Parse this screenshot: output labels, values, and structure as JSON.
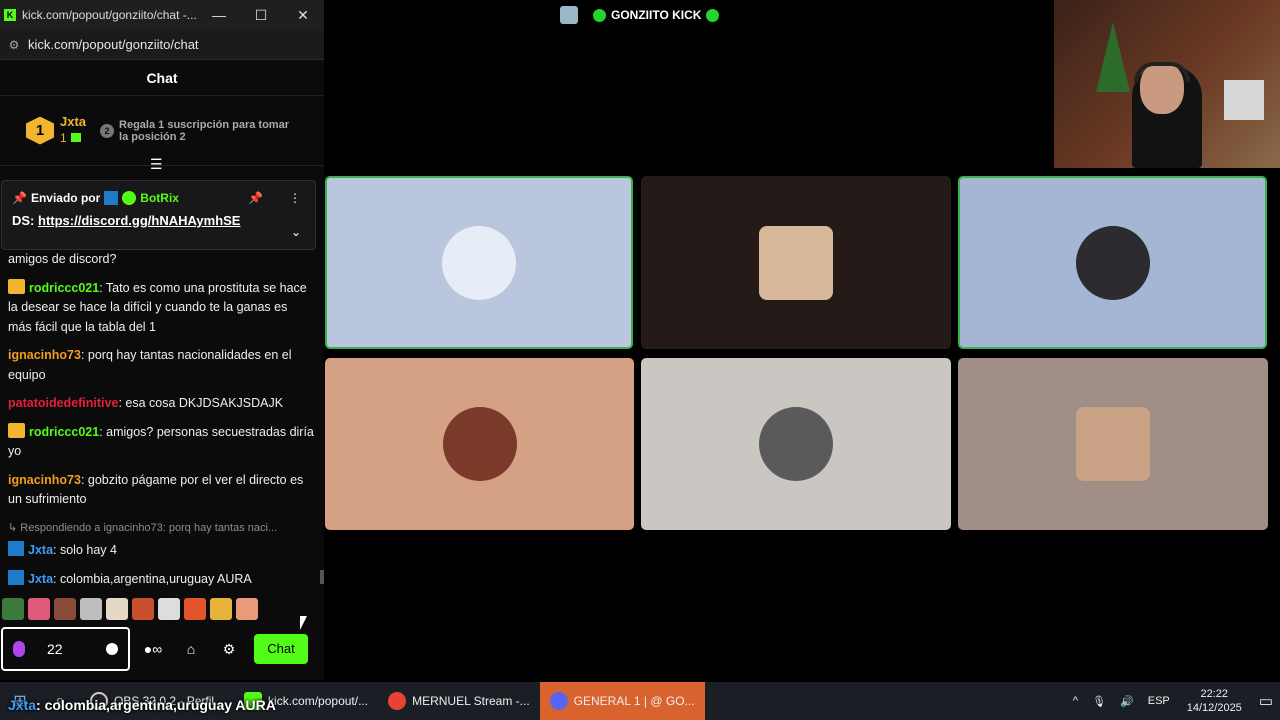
{
  "window": {
    "title": "kick.com/popout/gonziito/chat -...",
    "url": "kick.com/popout/gonziito/chat",
    "header": "Chat"
  },
  "leaderboard": {
    "rank": "1",
    "name": "Jxta",
    "count": "1",
    "slot2_rank": "2",
    "slot2_text": "Regala 1 suscripción para tomar la posición 2"
  },
  "pinned": {
    "sent_by": "Enviado por",
    "bot_name": "BotRix",
    "prefix": "DS:",
    "link": "https://discord.gg/hNAHAymhSE"
  },
  "messages": [
    {
      "user": "",
      "text": "amigos de discord?"
    },
    {
      "user": "rodriccc021",
      "color": "green",
      "badge": "crown",
      "text": ": Tato es como una prostituta se hace la desear se hace la difícil y cuando te la ganas es más fácil que la tabla del 1"
    },
    {
      "user": "ignacinho73",
      "color": "orange",
      "text": ": porq hay tantas nacionalidades en el equipo"
    },
    {
      "user": "patatoidedefinitive",
      "color": "red",
      "text": ": esa cosa DKJDSAKJSDAJK"
    },
    {
      "user": "rodriccc021",
      "color": "green",
      "badge": "crown",
      "text": ": amigos? personas secuestradas diría yo"
    },
    {
      "user": "ignacinho73",
      "color": "orange",
      "text": ": gobzito págame por el ver el directo es un sufrimiento"
    }
  ],
  "reply": "Respondiendo a ignacinho73: porq hay tantas naci...",
  "messages2": [
    {
      "user": "Jxta",
      "text": ": solo hay 4"
    },
    {
      "user": "Jxta",
      "text": ": colombia,argentina,uruguay AURA"
    }
  ],
  "input": {
    "value": "22",
    "send_label": "Chat"
  },
  "stream": {
    "title": "GONZIITO KICK"
  },
  "tiles": [
    {
      "bg": "#b9c6de",
      "active": true,
      "avatar": "#e6edf7"
    },
    {
      "bg": "#241a18",
      "active": false,
      "avatar": "#d8b89a"
    },
    {
      "bg": "#a4b6d3",
      "active": true,
      "avatar": "#2b2b30"
    },
    {
      "bg": "#d4a184",
      "active": false,
      "avatar": "#7a3a2a"
    },
    {
      "bg": "#cac6c2",
      "active": false,
      "avatar": "#5a5a5a"
    },
    {
      "bg": "#a18f87",
      "active": false,
      "avatar": "#c9a286"
    }
  ],
  "taskbar": {
    "apps": [
      {
        "label": "OBS 32.0.2 - Perfil...",
        "color": "#222"
      },
      {
        "label": "kick.com/popout/...",
        "color": "#53fc18"
      },
      {
        "label": "MERNUEL Stream -...",
        "color": "#e94235"
      },
      {
        "label": "GENERAL 1 | @ GO...",
        "color": "#5865f2"
      }
    ],
    "lang": "ESP",
    "time": "22:22",
    "date": "14/12/2025"
  },
  "overlay": {
    "user": "Jxta",
    "text": ": colombia,argentina,uruguay AURA"
  }
}
